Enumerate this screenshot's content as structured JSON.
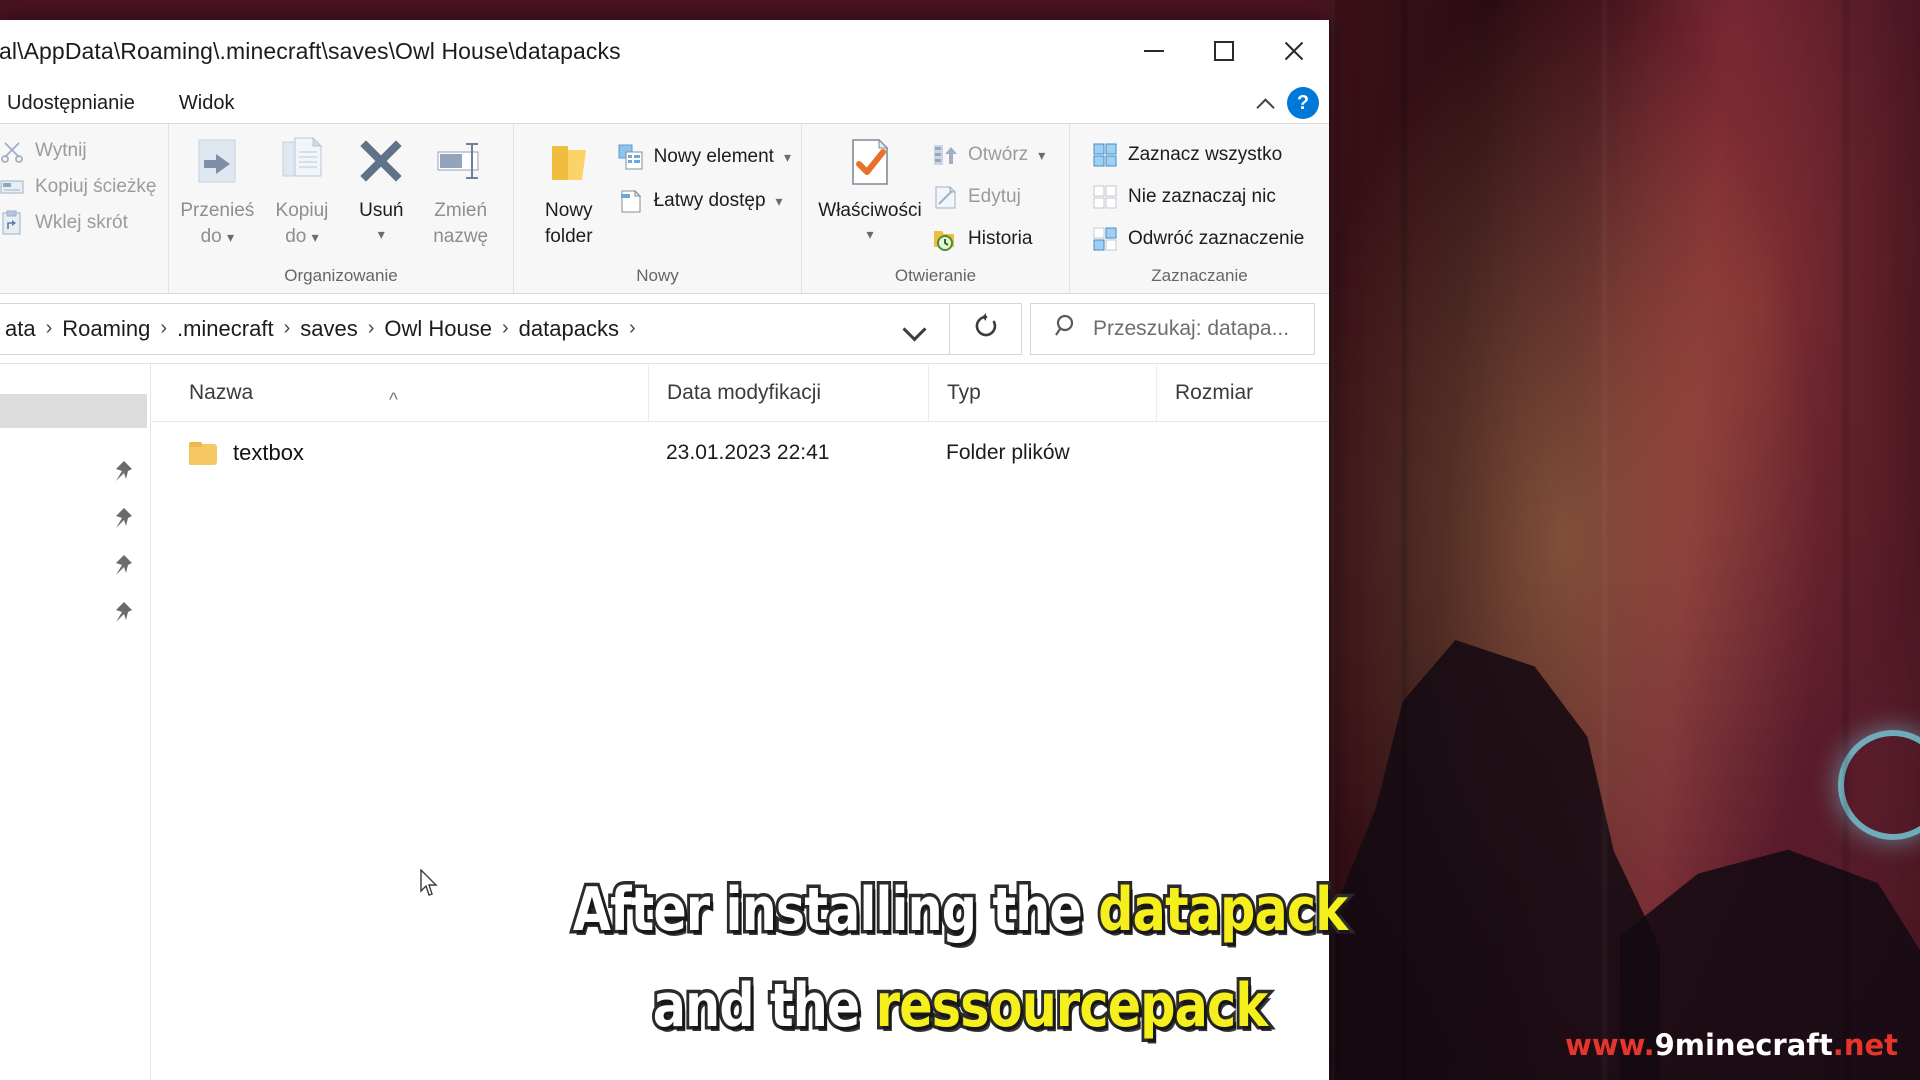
{
  "window": {
    "title": "al\\AppData\\Roaming\\.minecraft\\saves\\Owl House\\datapacks",
    "minimize_label": "Minimalizuj",
    "maximize_label": "Maksymalizuj",
    "close_label": "Zamknij"
  },
  "tabs": [
    {
      "label": "Udostępnianie"
    },
    {
      "label": "Widok"
    }
  ],
  "help": {
    "label": "?",
    "collapse_label": "^"
  },
  "ribbon": {
    "clipboard": {
      "items": [
        {
          "label": "Wytnij",
          "icon": "scissors-icon",
          "enabled": false
        },
        {
          "label": "Kopiuj ścieżkę",
          "icon": "copy-path-icon",
          "enabled": false
        },
        {
          "label": "Wklej skrót",
          "icon": "paste-shortcut-icon",
          "enabled": false
        }
      ]
    },
    "organize": {
      "label": "Organizowanie",
      "buttons": [
        {
          "label_line1": "Przenieś",
          "label_line2": "do",
          "icon": "move-to-icon",
          "has_caret": true
        },
        {
          "label_line1": "Kopiuj",
          "label_line2": "do",
          "icon": "copy-to-icon",
          "has_caret": true
        },
        {
          "label_line1": "Usuń",
          "label_line2": "",
          "icon": "delete-x-icon",
          "has_caret": true
        },
        {
          "label_line1": "Zmień",
          "label_line2": "nazwę",
          "icon": "rename-icon",
          "has_caret": false
        }
      ]
    },
    "new": {
      "label": "Nowy",
      "big": {
        "label_line1": "Nowy",
        "label_line2": "folder",
        "icon": "new-folder-icon"
      },
      "items": [
        {
          "label": "Nowy element",
          "icon": "new-item-icon",
          "has_caret": true
        },
        {
          "label": "Łatwy dostęp",
          "icon": "easy-access-icon",
          "has_caret": true
        }
      ]
    },
    "open": {
      "label": "Otwieranie",
      "big": {
        "label": "Właściwości",
        "icon": "properties-icon",
        "has_caret": true
      },
      "items": [
        {
          "label": "Otwórz",
          "icon": "open-icon",
          "has_caret": true,
          "enabled": false
        },
        {
          "label": "Edytuj",
          "icon": "edit-icon",
          "has_caret": false,
          "enabled": false
        },
        {
          "label": "Historia",
          "icon": "history-icon",
          "has_caret": false,
          "enabled": true
        }
      ]
    },
    "select": {
      "label": "Zaznaczanie",
      "items": [
        {
          "label": "Zaznacz wszystko",
          "icon": "select-all-icon"
        },
        {
          "label": "Nie zaznaczaj nic",
          "icon": "select-none-icon"
        },
        {
          "label": "Odwróć zaznaczenie",
          "icon": "invert-selection-icon"
        }
      ]
    }
  },
  "address": {
    "crumbs": [
      "ata",
      "Roaming",
      ".minecraft",
      "saves",
      "Owl House",
      "datapacks"
    ],
    "separator": "›",
    "trailing_separator": "›",
    "dropdown_icon": "chevron-down-icon",
    "refresh_icon": "refresh-icon"
  },
  "search": {
    "placeholder": "Przeszukaj: datapa...",
    "icon": "search-icon"
  },
  "columns": [
    {
      "label": "Nazwa",
      "sorted": true,
      "sort_glyph": "^"
    },
    {
      "label": "Data modyfikacji",
      "sorted": false
    },
    {
      "label": "Typ",
      "sorted": false
    },
    {
      "label": "Rozmiar",
      "sorted": false
    }
  ],
  "files": [
    {
      "name": "textbox",
      "modified": "23.01.2023 22:41",
      "type": "Folder plików",
      "size": "",
      "icon": "folder-icon"
    }
  ],
  "subtitles": {
    "line1_pre": "After installing the ",
    "line1_hl": "datapack",
    "line2_pre": "and the ",
    "line2_hl": "ressourcepack"
  },
  "watermark": {
    "www": "www.",
    "mid": "9minecraft",
    "net": ".net"
  },
  "colors": {
    "accent": "#0078d7",
    "highlight_yellow": "#f6ef1e",
    "watermark_red": "#e8352b",
    "folder_yellow": "#f6c863",
    "orange_check": "#e8702a"
  }
}
